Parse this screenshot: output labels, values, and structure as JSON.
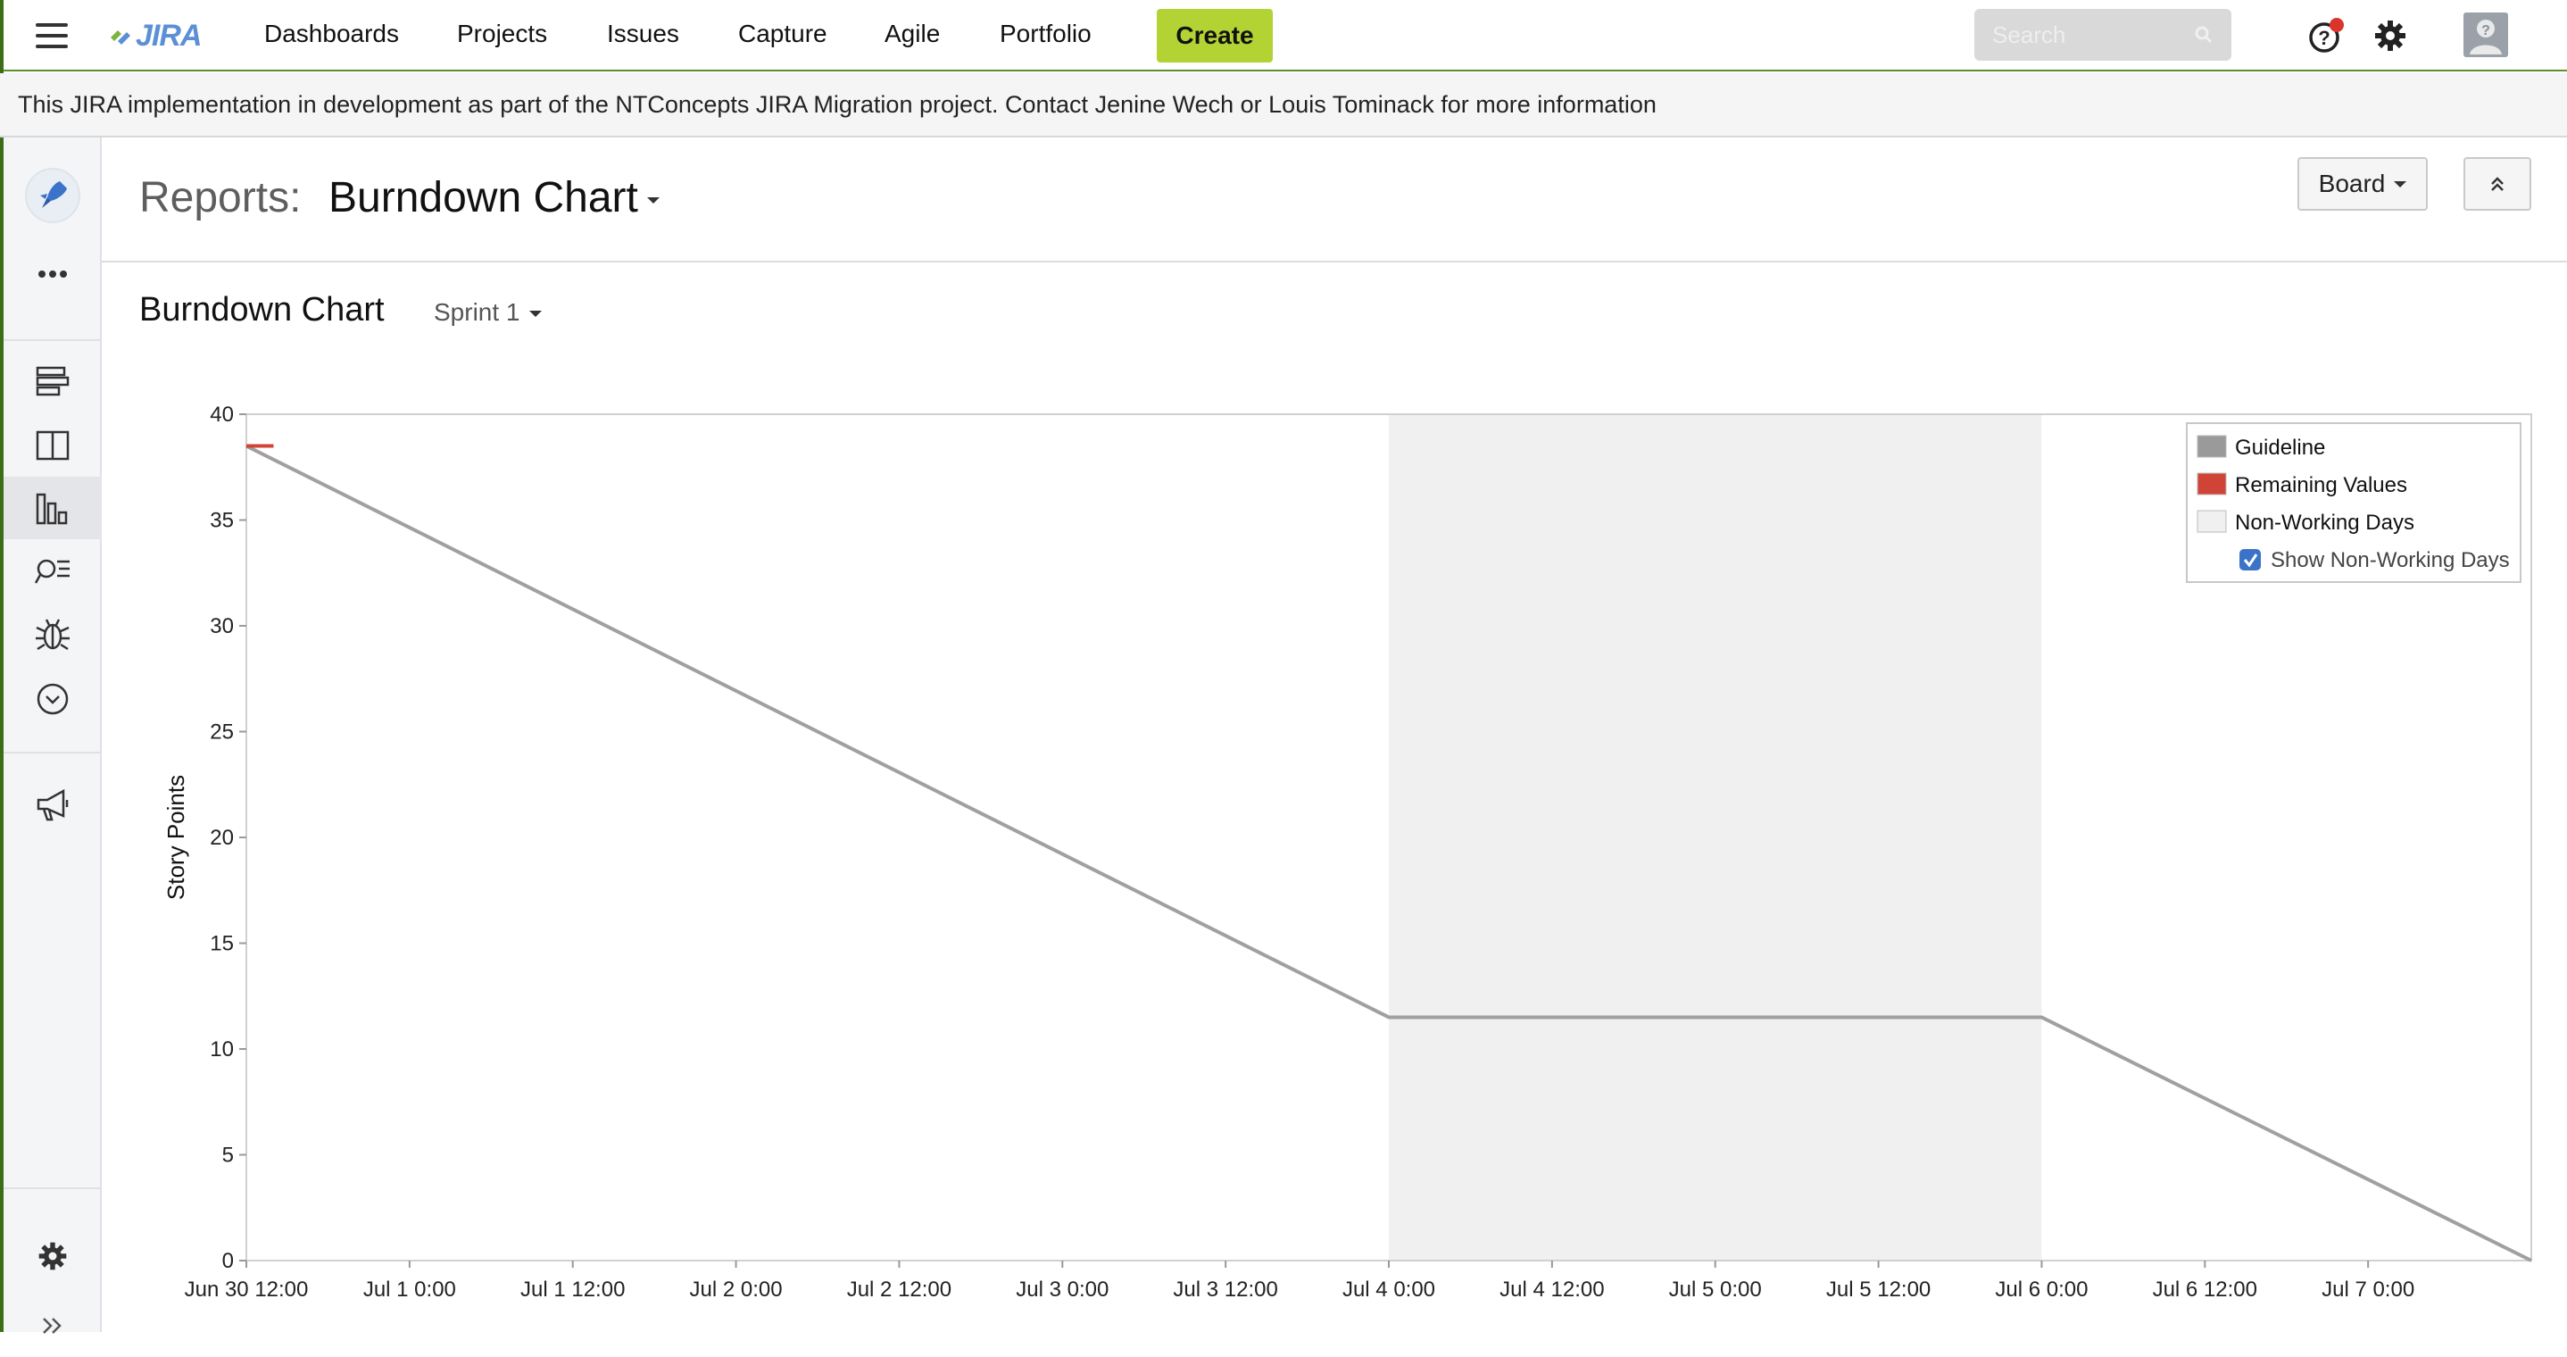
{
  "nav": {
    "logo_text": "JIRA",
    "items": [
      "Dashboards",
      "Projects",
      "Issues",
      "Capture",
      "Agile",
      "Portfolio"
    ],
    "create_label": "Create",
    "search_placeholder": "Search",
    "brand_color": "#b3d234"
  },
  "banner": {
    "text": "This JIRA implementation in development as part of the NTConcepts JIRA Migration project. Contact Jenine Wech or Louis Tominack for more information"
  },
  "sidebar": {
    "icons": [
      "rocket-icon",
      "more-icon",
      "backlog-icon",
      "board-icon",
      "reports-icon",
      "issue-search-icon",
      "bug-icon",
      "release-icon",
      "announcement-icon",
      "settings-icon",
      "expand-icon"
    ]
  },
  "header": {
    "reports_label": "Reports:",
    "report_title": "Burndown Chart",
    "board_label": "Board"
  },
  "chart_header": {
    "title": "Burndown Chart",
    "sprint": "Sprint 1"
  },
  "chart_data": {
    "type": "line",
    "title": "",
    "xlabel": "",
    "ylabel": "Story Points",
    "ylim": [
      0,
      40
    ],
    "yticks": [
      0,
      5,
      10,
      15,
      20,
      25,
      30,
      35,
      40
    ],
    "x_ticks": [
      "Jun 30 12:00",
      "Jul 1 0:00",
      "Jul 1 12:00",
      "Jul 2 0:00",
      "Jul 2 12:00",
      "Jul 3 0:00",
      "Jul 3 12:00",
      "Jul 4 0:00",
      "Jul 4 12:00",
      "Jul 5 0:00",
      "Jul 5 12:00",
      "Jul 6 0:00",
      "Jul 6 12:00",
      "Jul 7 0:00"
    ],
    "x_hours_range": [
      0,
      168
    ],
    "non_working": {
      "start_hours": 84,
      "end_hours": 132
    },
    "series": [
      {
        "name": "Guideline",
        "color": "#a0a0a0",
        "points": [
          [
            0,
            38.5
          ],
          [
            84,
            11.5
          ],
          [
            132,
            11.5
          ],
          [
            168,
            0
          ]
        ]
      },
      {
        "name": "Remaining Values",
        "color": "#d04437",
        "points": [
          [
            0,
            38.5
          ],
          [
            2,
            38.5
          ]
        ]
      }
    ],
    "legend": {
      "position": "top-right",
      "items": [
        {
          "label": "Guideline",
          "color": "#9a9a9a"
        },
        {
          "label": "Remaining Values",
          "color": "#d04437"
        },
        {
          "label": "Non-Working Days",
          "color": "#f0f0f0"
        }
      ],
      "checkbox_label": "Show Non-Working Days",
      "checked": true
    },
    "non_working_color": "#f0f0f0",
    "grid": false
  }
}
